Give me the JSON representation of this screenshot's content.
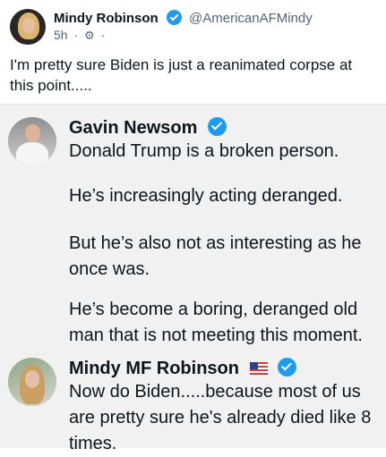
{
  "top_post": {
    "name": "Mindy Robinson",
    "handle": "@AmericanAFMindy",
    "time": "5h",
    "separator": "·",
    "audience_icon": "⚙",
    "text": "I'm pretty sure Biden is just a reanimated corpse at this point....."
  },
  "quote_card": {
    "gavin": {
      "name": "Gavin Newsom",
      "lines": [
        "Donald Trump is a broken person.",
        "He’s increasingly acting deranged.",
        "But he’s also not as interesting as he once was.",
        "He’s become a boring, deranged old man that is not meeting this moment."
      ]
    },
    "mindy": {
      "name": "Mindy MF Robinson",
      "text": "Now do Biden.....because most of us are pretty sure he's already died like 8 times."
    }
  },
  "colors": {
    "verified_blue": "#1d9bf0",
    "muted_text": "#536471",
    "quote_background": "#f1f1f1"
  },
  "icons": {
    "verified": "verified-badge-icon",
    "flag": "us-flag-icon",
    "audience": "audience-icon"
  }
}
